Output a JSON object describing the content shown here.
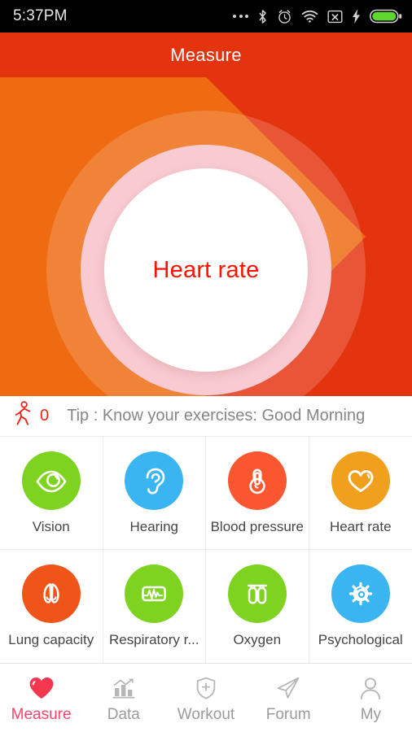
{
  "statusbar": {
    "time": "5:37PM",
    "icons": [
      "more-dots-icon",
      "bluetooth-icon",
      "alarm-clock-icon",
      "wifi-icon",
      "sim-card-off-icon",
      "charging-bolt-icon",
      "battery-full-icon"
    ]
  },
  "header": {
    "title": "Measure"
  },
  "hero": {
    "button_label": "Heart rate",
    "label_color": "#ff1100",
    "base_color": "#e4340f",
    "accent_color": "#ee6a12",
    "ring_color": "#f8cbd2"
  },
  "tipbar": {
    "icon": "walking-person-icon",
    "steps": "0",
    "tip": "Tip : Know your exercises: Good Morning",
    "steps_color": "#ef2211"
  },
  "grid": {
    "items": [
      {
        "label": "Vision",
        "icon": "eye-icon",
        "color": "#7ed321"
      },
      {
        "label": "Hearing",
        "icon": "ear-icon",
        "color": "#3bb4f2"
      },
      {
        "label": "Blood pressure",
        "icon": "thermometer-icon",
        "color": "#fa5630"
      },
      {
        "label": "Heart rate",
        "icon": "heart-outline-icon",
        "color": "#f0a01c"
      },
      {
        "label": "Lung capacity",
        "icon": "lungs-icon",
        "color": "#ef5418"
      },
      {
        "label": "Respiratory r...",
        "icon": "ecg-wave-icon",
        "color": "#7ed321"
      },
      {
        "label": "Oxygen",
        "icon": "oxygen-tank-icon",
        "color": "#7ed321"
      },
      {
        "label": "Psychological",
        "icon": "brain-gear-icon",
        "color": "#3bb4f2"
      }
    ]
  },
  "nav": {
    "active_color": "#f4476b",
    "inactive_color": "#9b9b9b",
    "items": [
      {
        "label": "Measure",
        "icon": "heart-filled-icon",
        "active": true
      },
      {
        "label": "Data",
        "icon": "bar-chart-icon",
        "active": false
      },
      {
        "label": "Workout",
        "icon": "shield-plus-icon",
        "active": false
      },
      {
        "label": "Forum",
        "icon": "paper-plane-icon",
        "active": false
      },
      {
        "label": "My",
        "icon": "person-icon",
        "active": false
      }
    ]
  }
}
